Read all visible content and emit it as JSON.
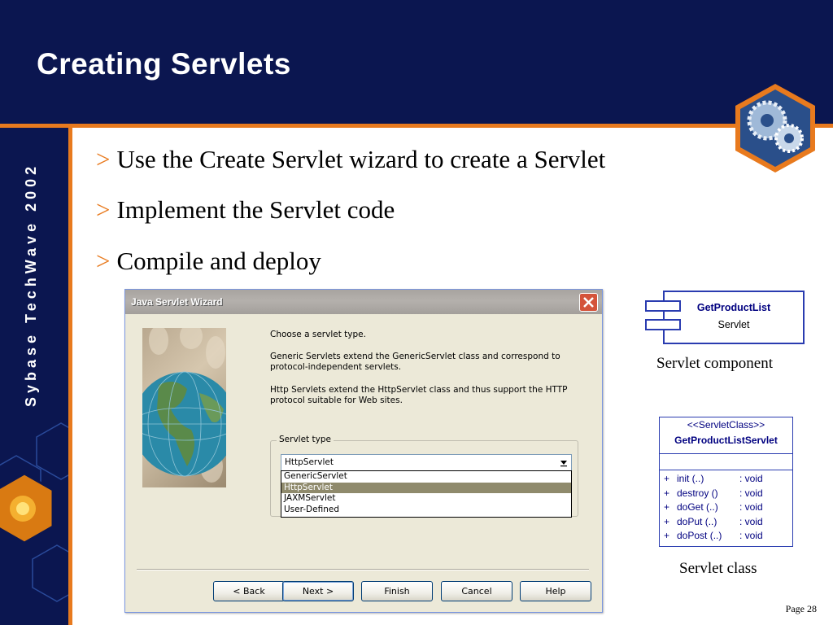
{
  "slide": {
    "title": "Creating Servlets",
    "sidebar_text": "Sybase TechWave 2002",
    "bullet_mark": ">",
    "bullets": [
      "Use the Create Servlet wizard to create a Servlet",
      "Implement the Servlet code",
      "Compile and deploy"
    ],
    "page_number": "Page 28"
  },
  "wizard": {
    "title": "Java Servlet Wizard",
    "intro": "Choose a servlet type.",
    "generic_desc": "Generic Servlets extend the GenericServlet class and correspond to protocol-independent servlets.",
    "http_desc": "Http Servlets extend the HttpServlet class and thus support the HTTP protocol suitable for Web sites.",
    "group_label": "Servlet type",
    "selected_type": "HttpServlet",
    "options": [
      "GenericServlet",
      "HttpServlet",
      "JAXMServlet",
      "User-Defined"
    ],
    "buttons": {
      "back": "< Back",
      "next": "Next >",
      "finish": "Finish",
      "cancel": "Cancel",
      "help": "Help"
    },
    "icons": {
      "close": "close-icon",
      "dropdown": "chevron-down-icon",
      "illustration": "globe-image"
    }
  },
  "component": {
    "name": "GetProductList",
    "type": "Servlet",
    "caption": "Servlet component"
  },
  "class": {
    "stereotype": "<<ServletClass>>",
    "name": "GetProductListServlet",
    "operations": [
      {
        "vis": "+",
        "name": "init (..)",
        "ret": ": void"
      },
      {
        "vis": "+",
        "name": "destroy ()",
        "ret": ": void"
      },
      {
        "vis": "+",
        "name": "doGet (..)",
        "ret": ": void"
      },
      {
        "vis": "+",
        "name": "doPut (..)",
        "ret": ": void"
      },
      {
        "vis": "+",
        "name": "doPost (..)",
        "ret": ": void"
      }
    ],
    "caption": "Servlet class"
  },
  "colors": {
    "navy": "#0b1650",
    "accent_orange": "#e87a1e",
    "uml_blue": "#2a3cb0"
  }
}
